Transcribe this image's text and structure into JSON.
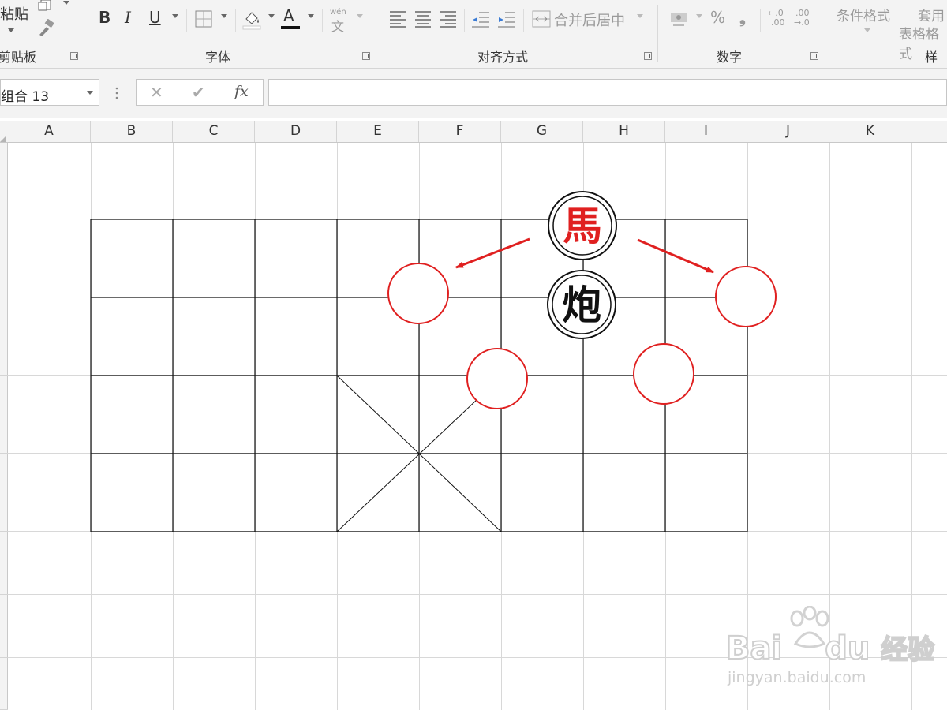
{
  "ribbon": {
    "clipboard": {
      "label": "剪贴板",
      "paste_label": "粘贴"
    },
    "font": {
      "label": "字体",
      "bold": "B",
      "italic": "I",
      "underline": "U",
      "font_color": "A",
      "phonetic_top": "wén",
      "phonetic_bottom": "文"
    },
    "alignment": {
      "label": "对齐方式",
      "merge_center": "合并后居中"
    },
    "number": {
      "label": "数字",
      "percent": "%",
      "comma": "❟",
      "increase_decimal_top": "←.0",
      "increase_decimal_bottom": ".00",
      "decrease_decimal_top": ".00",
      "decrease_decimal_bottom": "→.0"
    },
    "styles": {
      "label": "样式",
      "conditional_formatting": "条件格式",
      "format_as_table_top": "套用",
      "format_as_table_bottom": "表格格式"
    }
  },
  "formula_bar": {
    "name_box": "组合 13",
    "cancel": "✕",
    "enter": "✔",
    "fx": "fx",
    "content": ""
  },
  "columns": [
    "A",
    "B",
    "C",
    "D",
    "E",
    "F",
    "G",
    "H",
    "I",
    "J",
    "K"
  ],
  "pieces": {
    "horse": "馬",
    "cannon": "炮"
  },
  "colors": {
    "red": "#e02020",
    "black": "#111111",
    "ribbon_bg": "#f3f3f3",
    "grid_line": "#d4d4d4"
  },
  "watermark": {
    "brand": "Bai",
    "brand_tail": "du",
    "chinese": "经验",
    "url": "jingyan.baidu.com"
  }
}
